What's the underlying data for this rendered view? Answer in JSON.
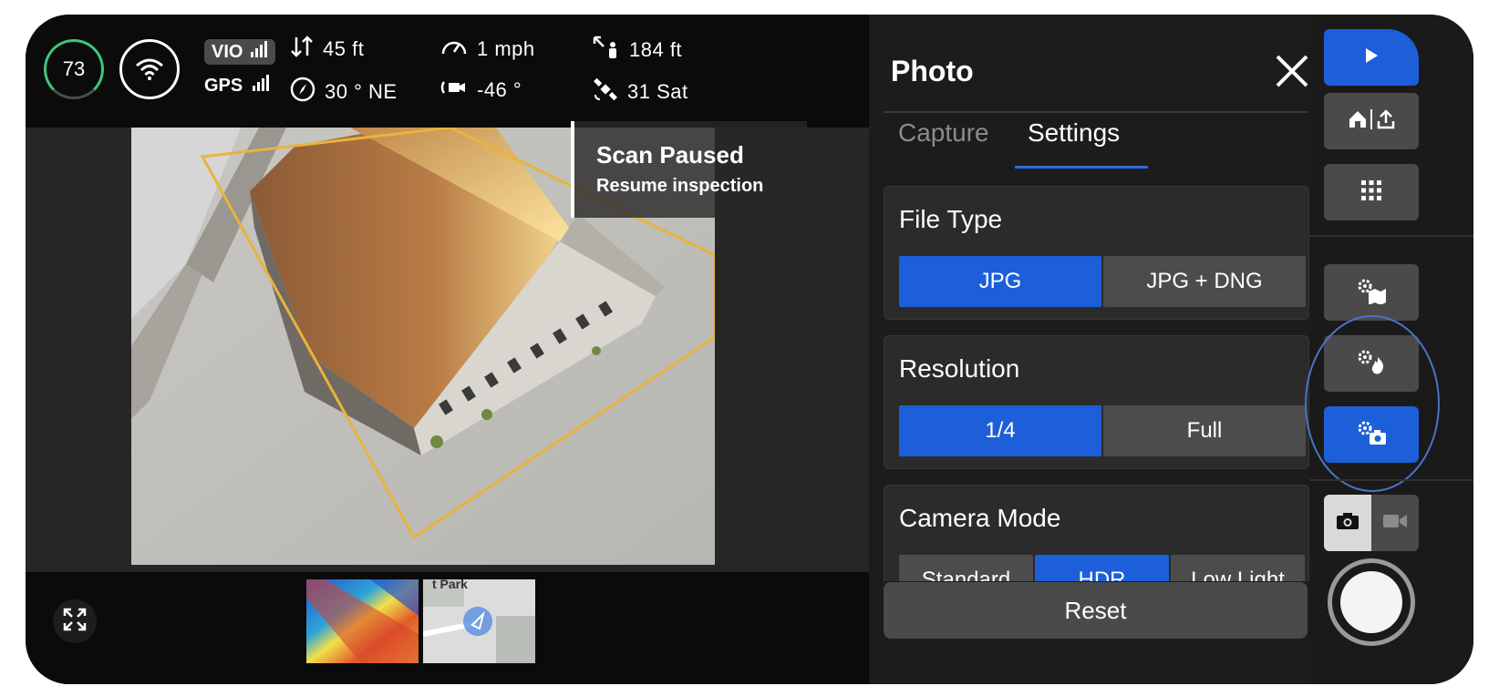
{
  "telemetry": {
    "battery_percent": "73",
    "vio_label": "VIO",
    "gps_label": "GPS",
    "altitude": "45 ft",
    "heading": "30 ° NE",
    "speed": "1 mph",
    "gimbal_pitch": "-46 °",
    "distance": "184 ft",
    "satellites": "31 Sat"
  },
  "video": {
    "scan_title": "Scan Paused",
    "scan_subtitle": "Resume inspection",
    "map_thumb_text": "t Park"
  },
  "panel": {
    "title": "Photo",
    "tabs": [
      {
        "label": "Capture",
        "active": false
      },
      {
        "label": "Settings",
        "active": true
      }
    ],
    "file_type": {
      "label": "File Type",
      "options": [
        "JPG",
        "JPG + DNG"
      ],
      "selected": "JPG"
    },
    "resolution": {
      "label": "Resolution",
      "options": [
        "1/4",
        "Full"
      ],
      "selected": "1/4"
    },
    "camera_mode": {
      "label": "Camera Mode",
      "options": [
        "Standard",
        "HDR",
        "Low Light"
      ],
      "selected": "HDR"
    },
    "reset_label": "Reset"
  },
  "rail": {
    "icons": [
      "play-icon",
      "home-upload-icon",
      "grid-icon",
      "map-settings-icon",
      "thermal-settings-icon",
      "camera-settings-icon",
      "camera-icon",
      "video-icon"
    ]
  },
  "colors": {
    "accent_blue": "#1c5fd8",
    "battery_green": "#3ec67a",
    "scan_outline": "#e9b33c"
  }
}
